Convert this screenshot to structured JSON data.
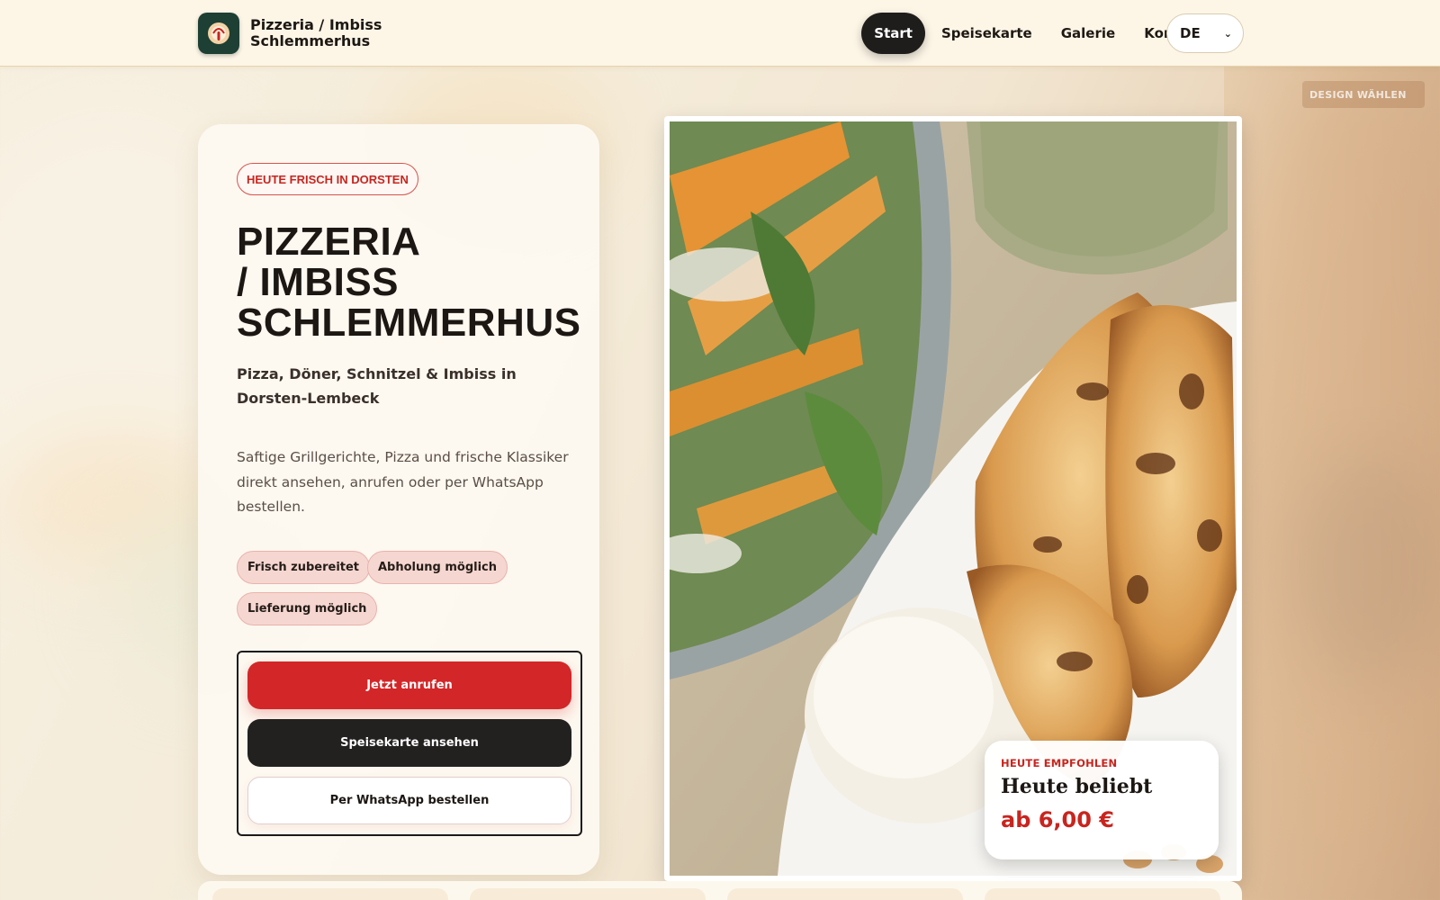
{
  "header": {
    "brand_line1": "Pizzeria / Imbiss",
    "brand_line2": "Schlemmerhus",
    "nav": [
      {
        "label": "Start",
        "active": true
      },
      {
        "label": "Speisekarte",
        "active": false
      },
      {
        "label": "Galerie",
        "active": false
      },
      {
        "label": "Kontakt",
        "active": false
      }
    ],
    "language": "DE"
  },
  "design_button": "DESIGN WÄHLEN",
  "hero": {
    "badge": "HEUTE FRISCH IN DORSTEN",
    "title_lines": [
      "PIZZERIA",
      "/ IMBISS",
      "SCHLEMMERHUS"
    ],
    "subtitle": "Pizza, Döner, Schnitzel & Imbiss in Dorsten-Lembeck",
    "description": "Saftige Grillgerichte, Pizza und frische Klassiker direkt ansehen, anrufen oder per WhatsApp bestellen.",
    "chips": [
      "Frisch zubereitet",
      "Abholung möglich",
      "Lieferung möglich"
    ],
    "buttons": {
      "call": "Jetzt anrufen",
      "menu": "Speisekarte ansehen",
      "whatsapp": "Per WhatsApp bestellen"
    }
  },
  "recommendation": {
    "kicker": "HEUTE EMPFOHLEN",
    "title": "Heute beliebt",
    "price": "ab 6,00 €"
  },
  "colors": {
    "accent_red": "#d32628",
    "dark": "#1f1d1c",
    "cream": "#fdf6e7",
    "logo_green": "#1d3f34"
  }
}
